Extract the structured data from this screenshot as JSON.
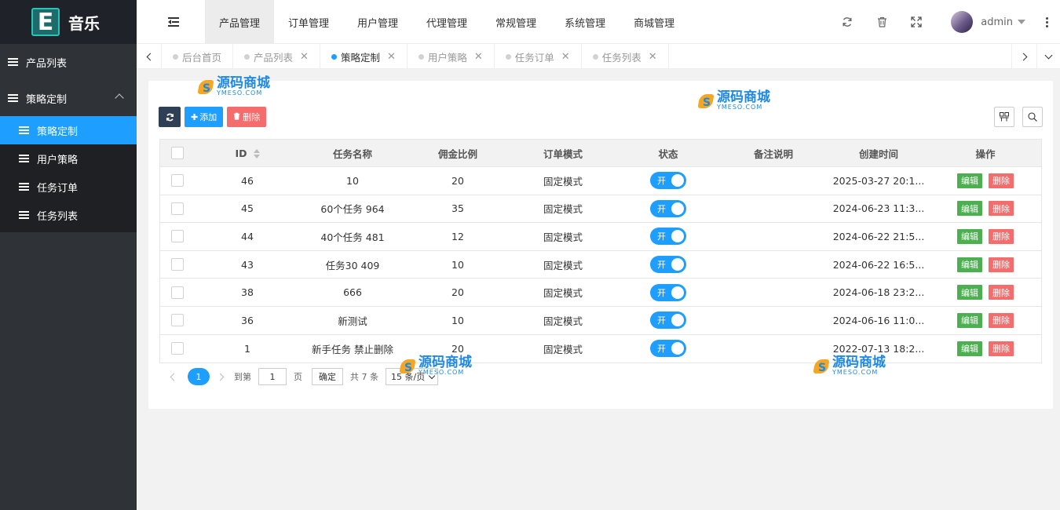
{
  "app": {
    "logo_letter": "E",
    "logo_text": "音乐"
  },
  "sidebar": {
    "items": [
      {
        "label": "产品列表"
      },
      {
        "label": "策略定制",
        "expanded": true
      }
    ],
    "subitems": [
      {
        "label": "策略定制",
        "active": true
      },
      {
        "label": "用户策略"
      },
      {
        "label": "任务订单"
      },
      {
        "label": "任务列表"
      }
    ]
  },
  "topnav": {
    "items": [
      "产品管理",
      "订单管理",
      "用户管理",
      "代理管理",
      "常规管理",
      "系统管理",
      "商城管理"
    ],
    "user": "admin"
  },
  "tabs": [
    {
      "label": "后台首页",
      "closable": false
    },
    {
      "label": "产品列表",
      "closable": true
    },
    {
      "label": "策略定制",
      "closable": true,
      "active": true
    },
    {
      "label": "用户策略",
      "closable": true
    },
    {
      "label": "任务订单",
      "closable": true
    },
    {
      "label": "任务列表",
      "closable": true
    }
  ],
  "toolbar": {
    "add_label": "添加",
    "delete_label": "删除"
  },
  "table": {
    "headers": [
      "ID",
      "任务名称",
      "佣金比例",
      "订单模式",
      "状态",
      "备注说明",
      "创建时间",
      "操作"
    ],
    "rows": [
      {
        "id": "46",
        "name": "10",
        "commission": "20",
        "mode": "固定模式",
        "state": "开",
        "note": "",
        "time": "2025-03-27 20:1..."
      },
      {
        "id": "45",
        "name": "60个任务 964",
        "commission": "35",
        "mode": "固定模式",
        "state": "开",
        "note": "",
        "time": "2024-06-23 11:3..."
      },
      {
        "id": "44",
        "name": "40个任务 481",
        "commission": "12",
        "mode": "固定模式",
        "state": "开",
        "note": "",
        "time": "2024-06-22 21:5..."
      },
      {
        "id": "43",
        "name": "任务30 409",
        "commission": "10",
        "mode": "固定模式",
        "state": "开",
        "note": "",
        "time": "2024-06-22 16:5..."
      },
      {
        "id": "38",
        "name": "666",
        "commission": "20",
        "mode": "固定模式",
        "state": "开",
        "note": "",
        "time": "2024-06-18 23:2..."
      },
      {
        "id": "36",
        "name": "新测试",
        "commission": "10",
        "mode": "固定模式",
        "state": "开",
        "note": "",
        "time": "2024-06-16 11:0..."
      },
      {
        "id": "1",
        "name": "新手任务 禁止删除",
        "commission": "20",
        "mode": "固定模式",
        "state": "开",
        "note": "",
        "time": "2022-07-13 18:2..."
      }
    ],
    "edit_label": "编辑",
    "delete_label": "删除"
  },
  "pager": {
    "current": "1",
    "goto_label": "到第",
    "goto_value": "1",
    "page_unit": "页",
    "confirm_label": "确定",
    "total_label": "共 7 条",
    "page_size": "15 条/页"
  },
  "watermark": {
    "cn": "源码商城",
    "en": "YMESO.COM"
  },
  "colors": {
    "accent": "#1e9fff",
    "danger": "#f56c6c",
    "success": "#4caf50",
    "sidebar": "#2f3338"
  }
}
